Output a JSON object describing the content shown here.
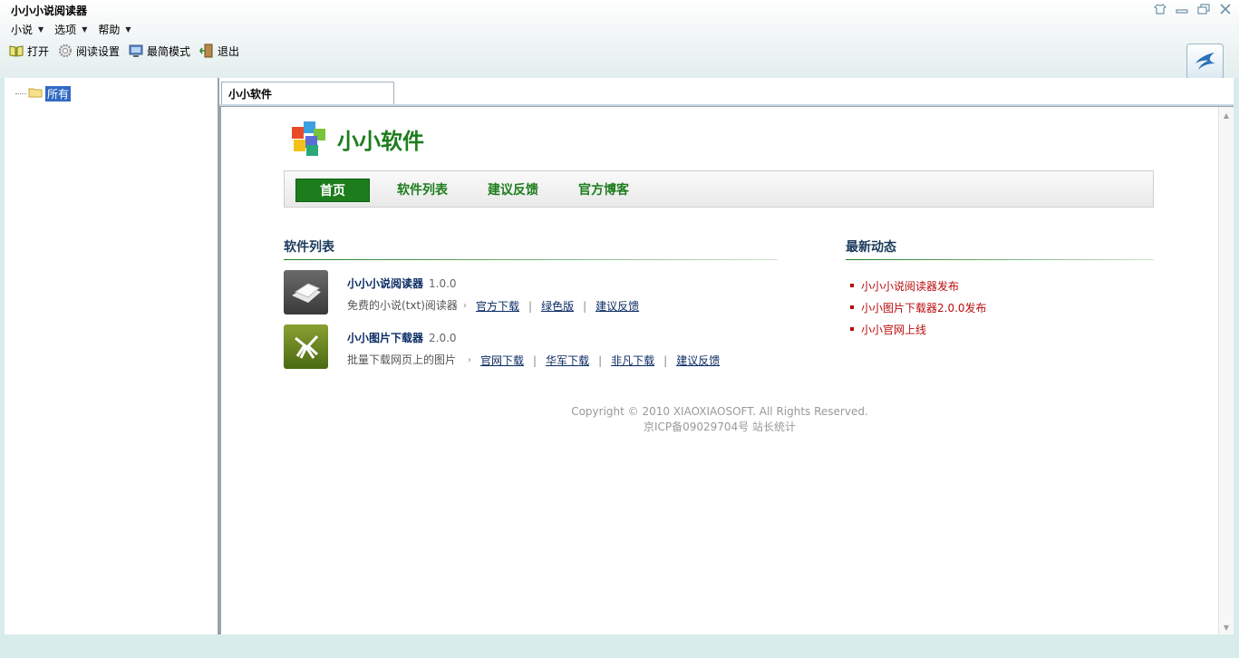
{
  "window": {
    "title": "小小小说阅读器"
  },
  "menubar": {
    "items": [
      "小说",
      "选项",
      "帮助"
    ]
  },
  "toolbar": {
    "open": "打开",
    "settings": "阅读设置",
    "simple_mode": "最简模式",
    "exit": "退出"
  },
  "tree": {
    "root": "所有"
  },
  "tabs": [
    {
      "label": "小小软件"
    }
  ],
  "page": {
    "site_name": "小小软件",
    "nav": [
      "首页",
      "软件列表",
      "建议反馈",
      "官方博客"
    ],
    "software_list_title": "软件列表",
    "news_title": "最新动态",
    "products": [
      {
        "name": "小小小说阅读器",
        "version": "1.0.0",
        "desc": "免费的小说(txt)阅读器",
        "links": [
          "官方下载",
          "绿色版",
          "建议反馈"
        ]
      },
      {
        "name": "小小图片下载器",
        "version": "2.0.0",
        "desc": "批量下载网页上的图片",
        "links": [
          "官网下载",
          "华军下载",
          "非凡下载",
          "建议反馈"
        ]
      }
    ],
    "news": [
      "小小小说阅读器发布",
      "小小图片下载器2.0.0发布",
      "小小官网上线"
    ],
    "footer": {
      "copyright": "Copyright © 2010 XIAOXIAOSOFT. All Rights Reserved.",
      "icp": "京ICP备09029704号 站长统计"
    }
  },
  "colors": {
    "brand_green": "#1d7d1d",
    "link_navy": "#0b2b63",
    "news_red": "#b80c0c",
    "selection_blue": "#316ac5"
  }
}
